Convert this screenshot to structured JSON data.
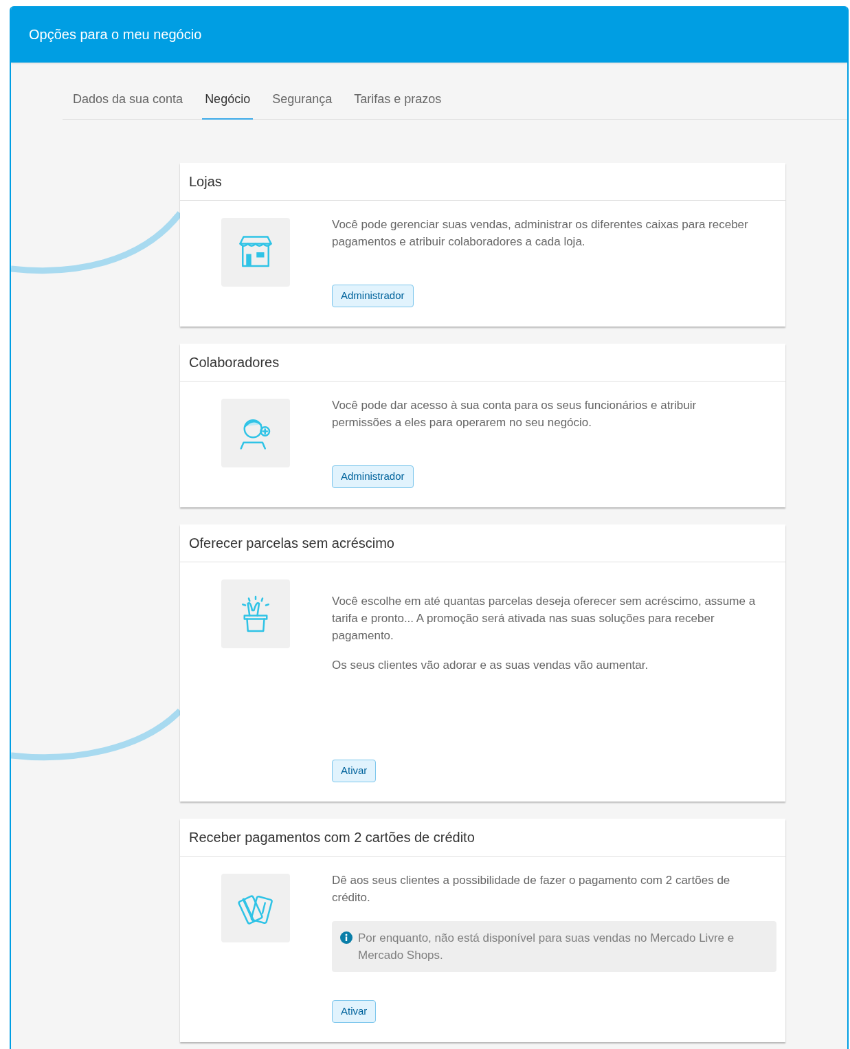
{
  "window": {
    "title": "Opções para o meu negócio"
  },
  "tabs": [
    {
      "label": "Dados da sua conta",
      "selected": false
    },
    {
      "label": "Negócio",
      "selected": true
    },
    {
      "label": "Segurança",
      "selected": false
    },
    {
      "label": "Tarifas e prazos",
      "selected": false
    }
  ],
  "cards": [
    {
      "title": "Lojas",
      "paragraphs": [
        "Você pode gerenciar suas vendas, administrar os diferentes caixas para receber pagamentos e atribuir colaboradores a cada loja."
      ],
      "button": "Administrador"
    },
    {
      "title": "Colaboradores",
      "paragraphs": [
        "Você pode dar acesso à sua conta para os seus funcionários e atribuir permissões a eles para operarem no seu negócio."
      ],
      "button": "Administrador"
    },
    {
      "title": "Oferecer parcelas sem acréscimo",
      "paragraphs": [
        "Você escolhe em até quantas parcelas deseja oferecer sem acréscimo, assume a tarifa e pronto... A promoção será ativada nas suas soluções para receber pagamento.",
        "Os seus clientes vão adorar e as suas vendas vão aumentar."
      ],
      "button": "Ativar"
    },
    {
      "title": "Receber pagamentos com 2 cartões de crédito",
      "paragraphs": [
        "Dê aos seus clientes a possibilidade de fazer o pagamento com 2 cartões de crédito."
      ],
      "notice": "Por enquanto, não está disponível para suas vendas no Mercado Livre e Mercado Shops.",
      "button": "Ativar"
    }
  ]
}
